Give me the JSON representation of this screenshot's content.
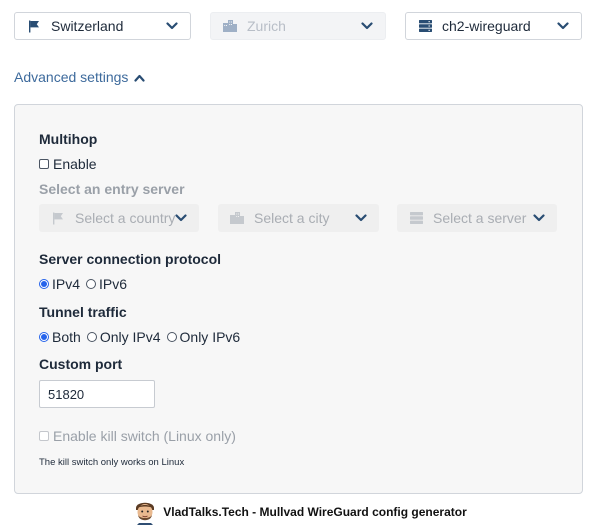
{
  "top_selects": {
    "country": {
      "value": "Switzerland",
      "icon": "flag-icon"
    },
    "city": {
      "value": "Zurich",
      "icon": "city-icon",
      "disabled": true
    },
    "server": {
      "value": "ch2-wireguard",
      "icon": "server-icon"
    }
  },
  "advanced": {
    "label": "Advanced settings"
  },
  "multihop": {
    "heading": "Multihop",
    "enable_label": "Enable",
    "entry_heading": "Select an entry server",
    "country_placeholder": "Select a country",
    "city_placeholder": "Select a city",
    "server_placeholder": "Select a server"
  },
  "protocol": {
    "heading": "Server connection protocol",
    "options": [
      "IPv4",
      "IPv6"
    ],
    "selected": "IPv4"
  },
  "tunnel": {
    "heading": "Tunnel traffic",
    "options": [
      "Both",
      "Only IPv4",
      "Only IPv6"
    ],
    "selected": "Both"
  },
  "port": {
    "heading": "Custom port",
    "value": "51820"
  },
  "killswitch": {
    "label": "Enable kill switch (Linux only)",
    "note": "The kill switch only works on Linux"
  },
  "footer": {
    "text": "VladTalks.Tech - Mullvad WireGuard config generator"
  },
  "colors": {
    "accent": "#2563eb",
    "link": "#3d6a9c",
    "chevron": "#294d73"
  }
}
